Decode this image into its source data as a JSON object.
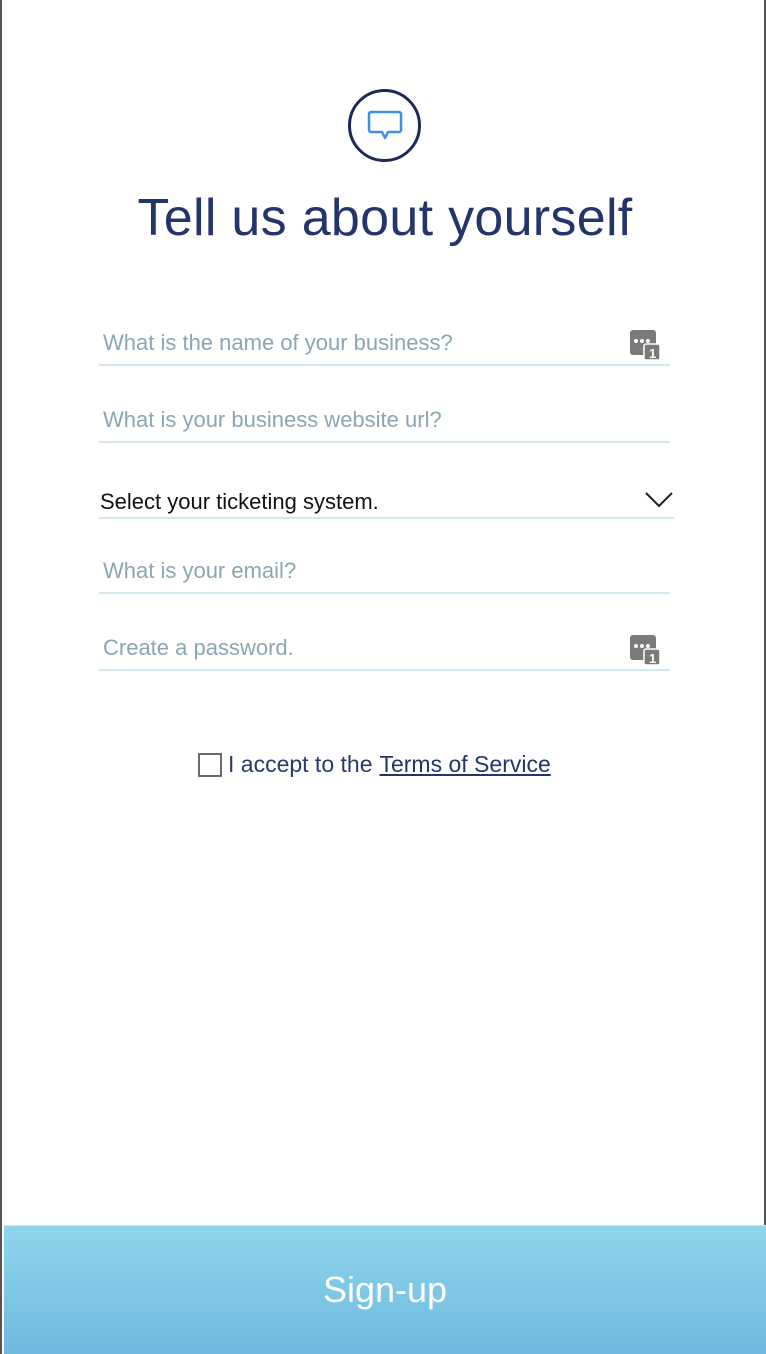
{
  "header": {
    "title": "Tell us about yourself",
    "logo_icon": "chat-bubble-icon"
  },
  "form": {
    "business_name": {
      "placeholder": "What is the name of your business?",
      "value": ""
    },
    "website_url": {
      "placeholder": "What is your business website url?",
      "value": ""
    },
    "ticketing_system": {
      "selected": "Select your ticketing system."
    },
    "email": {
      "placeholder": "What is your email?",
      "value": ""
    },
    "password": {
      "placeholder": "Create a password.",
      "value": ""
    }
  },
  "terms": {
    "prefix": "I accept to the",
    "link_label": "Terms of Service",
    "checked": false
  },
  "actions": {
    "signup_label": "Sign-up"
  },
  "colors": {
    "title": "#24356b",
    "placeholder": "#8aa6b0",
    "field_underline": "#d4e6f0",
    "button_top": "#8ed6ec",
    "button_bottom": "#6fb9df",
    "logo_bubble": "#3d8fe6"
  }
}
